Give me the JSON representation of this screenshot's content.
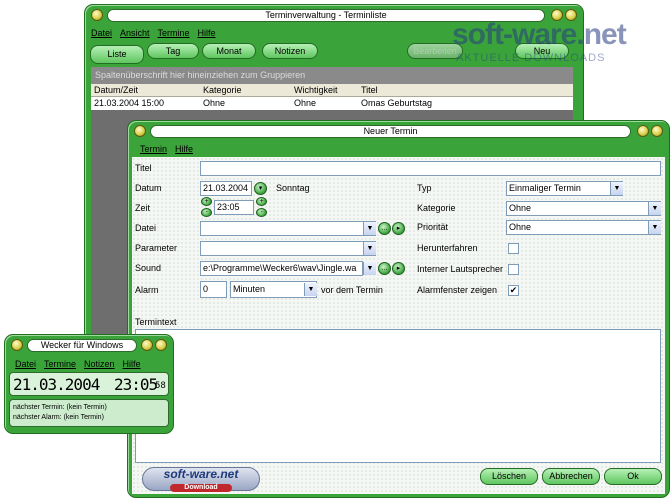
{
  "main_window": {
    "title": "Terminverwaltung - Terminliste",
    "menu": [
      "Datei",
      "Ansicht",
      "Termine",
      "Hilfe"
    ],
    "tabs": [
      "Liste",
      "Tag",
      "Monat",
      "Notizen"
    ],
    "right_buttons": [
      "Bearbeiten",
      "Neu"
    ],
    "group_hint": "Spaltenüberschrift hier hineinziehen zum Gruppieren",
    "columns": [
      "Datum/Zeit",
      "Kategorie",
      "Wichtigkeit",
      "Titel"
    ],
    "rows": [
      [
        "21.03.2004 15:00",
        "Ohne",
        "Ohne",
        "Omas Geburtstag"
      ]
    ]
  },
  "dialog": {
    "title": "Neuer Termin",
    "menu": [
      "Termin",
      "Hilfe"
    ],
    "labels": {
      "titel": "Titel",
      "datum": "Datum",
      "zeit": "Zeit",
      "datei": "Datei",
      "parameter": "Parameter",
      "sound": "Sound",
      "alarm": "Alarm",
      "typ": "Typ",
      "kategorie": "Kategorie",
      "prioritaet": "Priorität",
      "herunterfahren": "Herunterfahren",
      "lautsprecher": "Interner Lautsprecher",
      "alarmfenster": "Alarmfenster zeigen",
      "termintext": "Termintext",
      "vor_dem_termin": "vor dem Termin"
    },
    "values": {
      "titel": "",
      "datum": "21.03.2004",
      "wochentag": "Sonntag",
      "zeit": "23:05",
      "datei": "",
      "parameter": "",
      "sound": "e:\\Programme\\Wecker6\\wav\\Jingle.wa",
      "alarm": "0",
      "alarm_einheit": "Minuten",
      "typ": "Einmaliger Termin",
      "kategorie": "Ohne",
      "prioritaet": "Ohne"
    },
    "checkboxes": {
      "herunterfahren": false,
      "lautsprecher": false,
      "alarmfenster": true
    },
    "buttons": {
      "loeschen": "Löschen",
      "abbrechen": "Abbrechen",
      "ok": "Ok"
    },
    "logo_text": "soft-ware.net",
    "logo_sub": "Download"
  },
  "small_window": {
    "title": "Wecker für Windows",
    "menu": [
      "Datei",
      "Termine",
      "Notizen",
      "Hilfe"
    ],
    "date": "21.03.2004",
    "time": "23:05",
    "seconds": "58",
    "next_termin": "nächster Termin:  (kein Termin)",
    "next_alarm": "nächster Alarm:  (kein Termin)"
  },
  "watermark": {
    "brand": "soft-ware.net",
    "sub": "AKTUELLE DOWNLOADS"
  },
  "colors": {
    "frame": "#3aa43a",
    "accent": "#5fc65f",
    "brand_blue": "#1f3a7a"
  }
}
